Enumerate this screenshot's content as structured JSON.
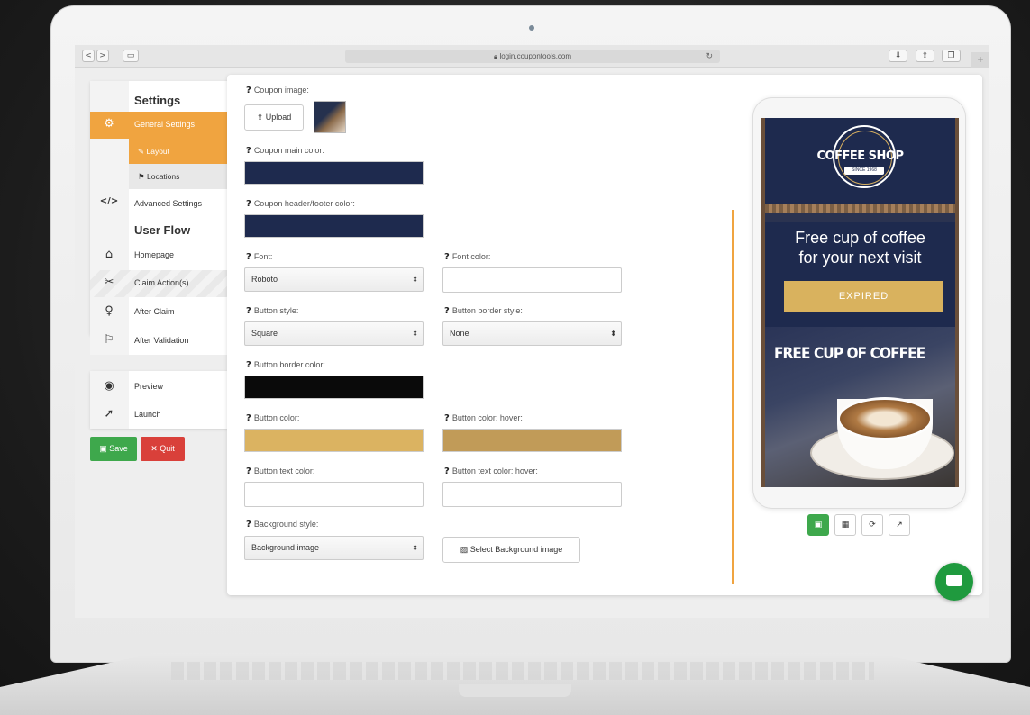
{
  "browser": {
    "url": "login.coupontools.com",
    "nav_back": "<",
    "nav_forward": ">",
    "reload": "↻",
    "plus": "+"
  },
  "sidebar": {
    "settings_heading": "Settings",
    "general_settings": "General Settings",
    "layout": "Layout",
    "locations": "Locations",
    "advanced_settings": "Advanced Settings",
    "user_flow_heading": "User Flow",
    "homepage": "Homepage",
    "claim_actions": "Claim Action(s)",
    "after_claim": "After Claim",
    "after_validation": "After Validation",
    "preview": "Preview",
    "launch": "Launch",
    "save": "Save",
    "quit": "Quit",
    "icons": {
      "general": "⚙",
      "layout": "✎",
      "locations": "⚑",
      "advanced": "</>",
      "homepage": "⌂",
      "claim": "✂",
      "after_claim": "♀",
      "after_validation": "⚐",
      "preview": "◉",
      "launch": "➚",
      "save": "▣",
      "quit": "✕"
    }
  },
  "form": {
    "coupon_image": "Coupon image:",
    "upload": "Upload",
    "coupon_main_color": "Coupon main color:",
    "header_footer_color": "Coupon header/footer color:",
    "font": "Font:",
    "font_value": "Roboto",
    "font_color": "Font color:",
    "button_style": "Button style:",
    "button_style_value": "Square",
    "button_border_style": "Button border style:",
    "button_border_style_value": "None",
    "button_border_color": "Button border color:",
    "button_color": "Button color:",
    "button_color_hover": "Button color: hover:",
    "button_text_color": "Button text color:",
    "button_text_color_hover": "Button text color: hover:",
    "background_style": "Background style:",
    "background_style_value": "Background image",
    "select_background": "Select Background image",
    "help": "?",
    "colors": {
      "main": "#1e2a4e",
      "header_footer": "#1e2a4e",
      "font": "#ffffff",
      "border": "#0a0a0a",
      "button": "#dbb361",
      "button_hover": "#c19b58",
      "button_text": "#ffffff",
      "button_text_hover": "#ffffff"
    }
  },
  "preview": {
    "shop_name": "COFFEE SHOP",
    "since": "SINCE 1968",
    "headline_line1": "Free cup of coffee",
    "headline_line2": "for your next visit",
    "expired": "EXPIRED",
    "photo_title": "FREE CUP OF COFFEE"
  },
  "toolbar": {
    "save_icon": "save-icon",
    "qr_icon": "qr-icon",
    "refresh_icon": "refresh-icon",
    "stats_icon": "stats-icon"
  }
}
